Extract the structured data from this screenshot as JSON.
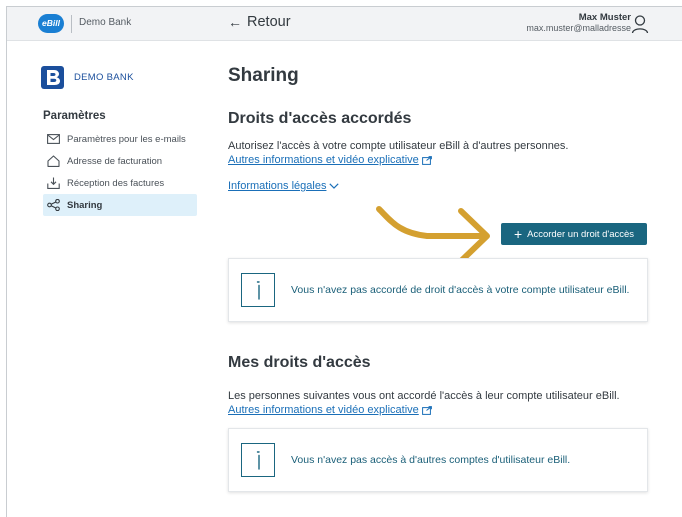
{
  "topbar": {
    "logo_text": "eBill",
    "bank_name": "Demo Bank",
    "back_label": "Retour",
    "user_name": "Max Muster",
    "user_email": "max.muster@malladresse"
  },
  "sidebar": {
    "bank_logo_text": "DEMO BANK",
    "heading": "Paramètres",
    "items": [
      {
        "label": "Paramètres pour les e-mails",
        "icon": "mail-icon"
      },
      {
        "label": "Adresse de facturation",
        "icon": "home-icon"
      },
      {
        "label": "Réception des factures",
        "icon": "inbox-icon"
      },
      {
        "label": "Sharing",
        "icon": "share-icon",
        "active": true
      }
    ]
  },
  "main": {
    "page_title": "Sharing",
    "granted": {
      "title": "Droits d'accès accordés",
      "description": "Autorisez l'accès à votre compte utilisateur eBill à d'autres personnes.",
      "info_link": "Autres informations et vidéo explicative",
      "legal_link": "Informations légales",
      "grant_button": "Accorder un droit d'accès",
      "empty_message": "Vous n'avez pas accordé de droit d'accès à votre compte utilisateur eBill."
    },
    "mine": {
      "title": "Mes droits d'accès",
      "description": "Les personnes suivantes vous ont accordé l'accès à leur compte utilisateur eBill.",
      "info_link": "Autres informations et vidéo explicative",
      "empty_message": "Vous n'avez pas accès à d'autres comptes d'utilisateur eBill."
    }
  },
  "colors": {
    "accent": "#1a6680",
    "link": "#1a6fb8",
    "highlight_arrow": "#d4a030",
    "active_item_bg": "#def0fa"
  }
}
